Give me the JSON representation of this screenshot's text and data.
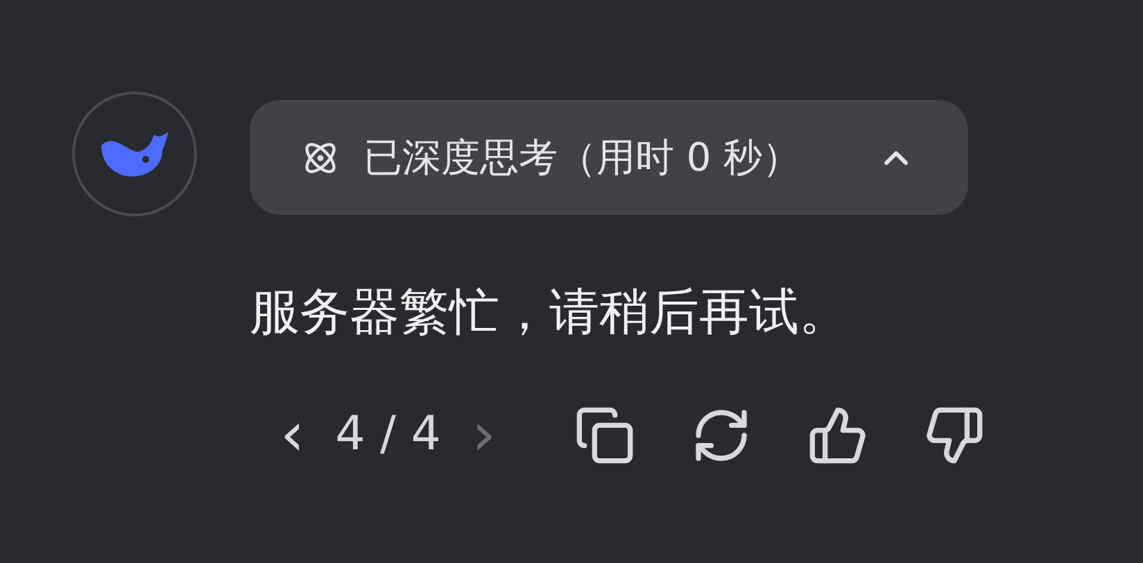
{
  "thinking": {
    "label": "已深度思考（用时 0 秒）",
    "expanded": true
  },
  "message": {
    "text": "服务器繁忙，请稍后再试。"
  },
  "pager": {
    "prev": {
      "symbol": "‹",
      "disabled": false
    },
    "counter": "4 / 4",
    "next": {
      "symbol": "›",
      "disabled": true
    }
  },
  "actions": [
    {
      "kind": "copy"
    },
    {
      "kind": "regenerate"
    },
    {
      "kind": "like"
    },
    {
      "kind": "dislike"
    }
  ]
}
